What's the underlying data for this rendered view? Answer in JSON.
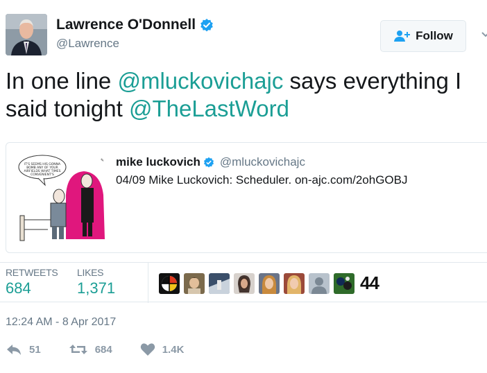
{
  "tweet": {
    "author": {
      "name": "Lawrence O'Donnell",
      "handle": "@Lawrence"
    },
    "follow_label": "Follow",
    "text_parts": {
      "t1": "In one line ",
      "m1": "@mluckovichajc",
      "t2": " says everything I",
      "t3": "said tonight ",
      "m2": "@TheLastWord"
    },
    "quoted": {
      "name": "mike luckovich",
      "handle": "@mluckovichajc",
      "text": "04/09 Mike Luckovich: Scheduler. on-ajc.com/2ohGOBJ",
      "cartoon_caption": "IT'S SEEMS HIS GONNA BOMB ANY OF YOUR AIRFIELDS WHAT TIMES CONVENIENT'S"
    },
    "stats": {
      "retweets_label": "RETWEETS",
      "retweets_value": "684",
      "likes_label": "LIKES",
      "likes_value": "1,371",
      "likers_more": "44"
    },
    "timestamp": "12:24 AM - 8 Apr 2017",
    "actions": {
      "reply_count": "51",
      "retweet_count": "684",
      "like_count": "1.4K"
    }
  },
  "colors": {
    "link": "#1b9e95",
    "muted": "#657786",
    "verified": "#1da1f2",
    "border": "#e1e8ed"
  },
  "icons": [
    "verified-icon",
    "follow-person-icon",
    "chevron-down-icon",
    "reply-icon",
    "retweet-icon",
    "heart-icon"
  ]
}
